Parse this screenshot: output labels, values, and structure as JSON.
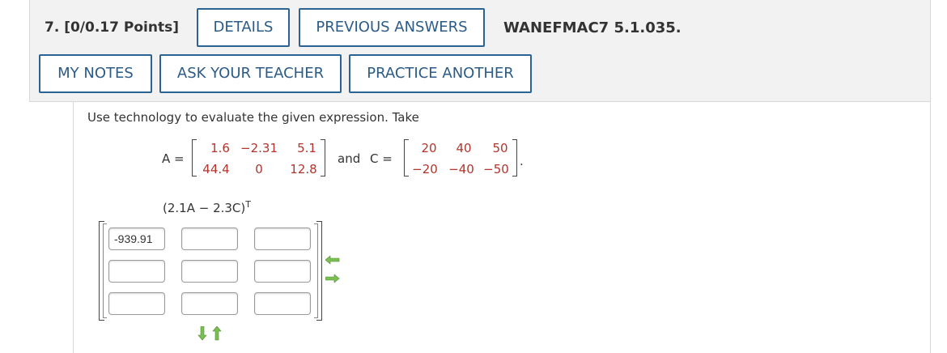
{
  "question": {
    "number_label": "7. [0/0.17 Points]",
    "reference": "WANEFMAC7 5.1.035."
  },
  "buttons": {
    "details": "DETAILS",
    "previous_answers": "PREVIOUS ANSWERS",
    "my_notes": "MY NOTES",
    "ask_teacher": "ASK YOUR TEACHER",
    "practice_another": "PRACTICE ANOTHER"
  },
  "problem": {
    "prompt": "Use technology to evaluate the given expression. Take",
    "matrix_a_label": "A =",
    "matrix_a": [
      [
        "1.6",
        "−2.31",
        "5.1"
      ],
      [
        "44.4",
        "0",
        "12.8"
      ]
    ],
    "and_text": "and",
    "matrix_c_label": "C =",
    "matrix_c": [
      [
        "20",
        "40",
        "50"
      ],
      [
        "−20",
        "−40",
        "−50"
      ]
    ],
    "period": ".",
    "expression": "(2.1A − 2.3C)",
    "expression_sup": "T"
  },
  "answer": {
    "cells": [
      [
        "-939.91",
        "",
        ""
      ],
      [
        "",
        "",
        ""
      ],
      [
        "",
        "",
        ""
      ]
    ]
  },
  "colors": {
    "button_border": "#2b6393",
    "button_text": "#2b5b86",
    "matrix_value": "#b3342c",
    "arrow_green": "#7bbf52",
    "header_bg": "#f2f2f2"
  },
  "icons": [
    "arrow-left-icon",
    "arrow-right-icon",
    "arrow-down-icon",
    "arrow-up-icon"
  ]
}
